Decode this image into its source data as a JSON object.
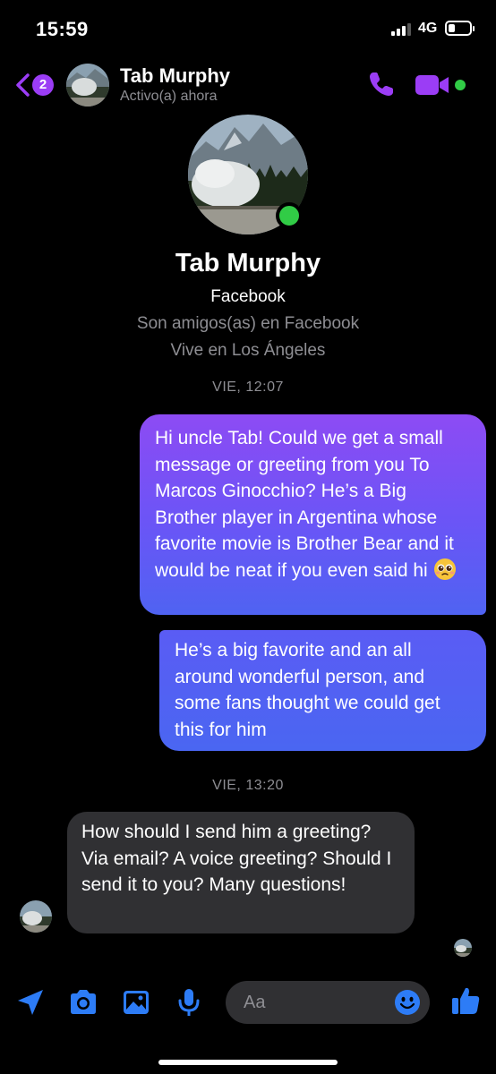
{
  "status_bar": {
    "time": "15:59",
    "network": "4G"
  },
  "header": {
    "back_badge_count": "2",
    "contact_name": "Tab Murphy",
    "contact_status": "Activo(a) ahora",
    "icons": [
      "chevron-left-icon",
      "phone-icon",
      "video-camera-icon"
    ],
    "accent_color": "#9b3df5",
    "online_color": "#31cc46"
  },
  "profile": {
    "name": "Tab Murphy",
    "source": "Facebook",
    "friends_text": "Son amigos(as) en Facebook",
    "lives_text": "Vive en Los Ángeles"
  },
  "conversation": {
    "timestamp_1": "VIE, 12:07",
    "message_1": "Hi uncle Tab! Could we get a small message or greeting from you To Marcos Ginocchio? He’s a Big Brother player in Argentina whose favorite movie is Brother Bear and it would be neat if you even said hi",
    "message_1_emoji": "pleading-face-emoji",
    "message_2": "He’s a big favorite and an all around wonderful person, and some fans thought we could get this for him",
    "timestamp_2": "VIE, 13:20",
    "message_3": "How should I send him a greeting? Via email? A voice greeting? Should I send it to you? Many questions!"
  },
  "composer": {
    "placeholder": "Aa",
    "icons": [
      "location-arrow-icon",
      "camera-icon",
      "image-icon",
      "microphone-icon",
      "emoji-icon",
      "thumbs-up-icon"
    ],
    "accent_color": "#2d7cf6"
  }
}
